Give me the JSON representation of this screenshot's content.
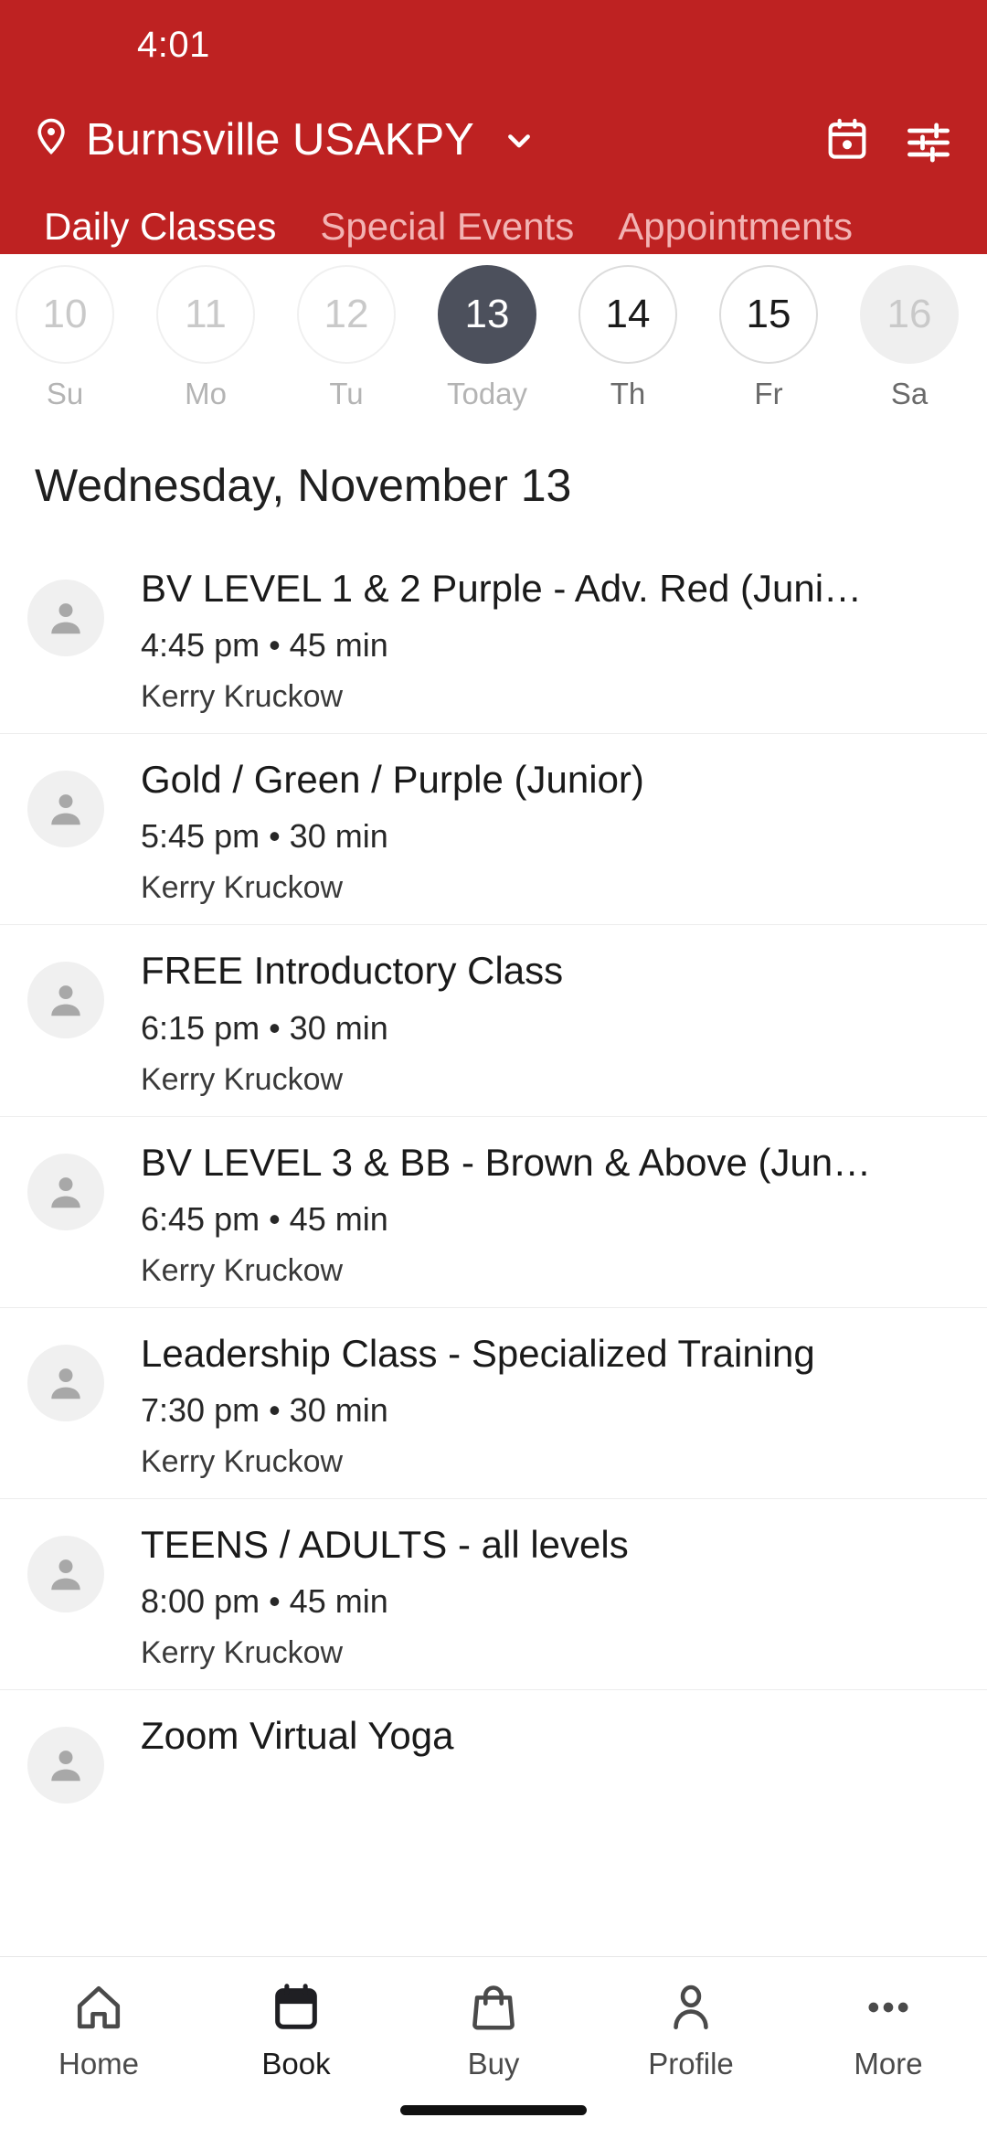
{
  "status": {
    "time": "4:01"
  },
  "header": {
    "location": "Burnsville USAKPY",
    "pin_icon": "location-pin-icon",
    "chevron_icon": "chevron-down-icon",
    "calendar_icon": "calendar-icon",
    "filter_icon": "filter-tune-icon",
    "background_color": "#BE2222",
    "tabs": [
      {
        "label": "Daily Classes",
        "active": true
      },
      {
        "label": "Special Events",
        "active": false
      },
      {
        "label": "Appointments",
        "active": false
      }
    ]
  },
  "date_strip": {
    "days": [
      {
        "num": "10",
        "label": "Su",
        "state": "past"
      },
      {
        "num": "11",
        "label": "Mo",
        "state": "past"
      },
      {
        "num": "12",
        "label": "Tu",
        "state": "past"
      },
      {
        "num": "13",
        "label": "Today",
        "state": "today"
      },
      {
        "num": "14",
        "label": "Th",
        "state": "future"
      },
      {
        "num": "15",
        "label": "Fr",
        "state": "future"
      },
      {
        "num": "16",
        "label": "Sa",
        "state": "disabled"
      }
    ],
    "today_color": "#4C505C"
  },
  "day_title": "Wednesday, November 13",
  "classes": [
    {
      "title": "BV LEVEL 1 & 2 Purple - Adv. Red (Juni…",
      "time": "4:45 pm • 45 min",
      "instructor": "Kerry Kruckow",
      "avatar_icon": "person-avatar-icon"
    },
    {
      "title": "Gold / Green / Purple (Junior)",
      "time": "5:45 pm • 30 min",
      "instructor": "Kerry Kruckow",
      "avatar_icon": "person-avatar-icon"
    },
    {
      "title": "FREE Introductory Class",
      "time": "6:15 pm • 30 min",
      "instructor": "Kerry Kruckow",
      "avatar_icon": "person-avatar-icon"
    },
    {
      "title": "BV LEVEL 3 & BB - Brown & Above (Jun…",
      "time": "6:45 pm • 45 min",
      "instructor": "Kerry Kruckow",
      "avatar_icon": "person-avatar-icon"
    },
    {
      "title": "Leadership Class - Specialized Training",
      "time": "7:30 pm • 30 min",
      "instructor": "Kerry Kruckow",
      "avatar_icon": "person-avatar-icon"
    },
    {
      "title": "TEENS / ADULTS - all levels",
      "time": "8:00 pm • 45 min",
      "instructor": "Kerry Kruckow",
      "avatar_icon": "person-avatar-icon"
    },
    {
      "title": "Zoom Virtual Yoga",
      "time": "",
      "instructor": "",
      "avatar_icon": "person-avatar-icon"
    }
  ],
  "bottom_nav": {
    "items": [
      {
        "label": "Home",
        "icon": "home-icon",
        "active": false
      },
      {
        "label": "Book",
        "icon": "calendar-icon",
        "active": true
      },
      {
        "label": "Buy",
        "icon": "shopping-bag-icon",
        "active": false
      },
      {
        "label": "Profile",
        "icon": "person-icon",
        "active": false
      },
      {
        "label": "More",
        "icon": "more-dots-icon",
        "active": false
      }
    ]
  }
}
